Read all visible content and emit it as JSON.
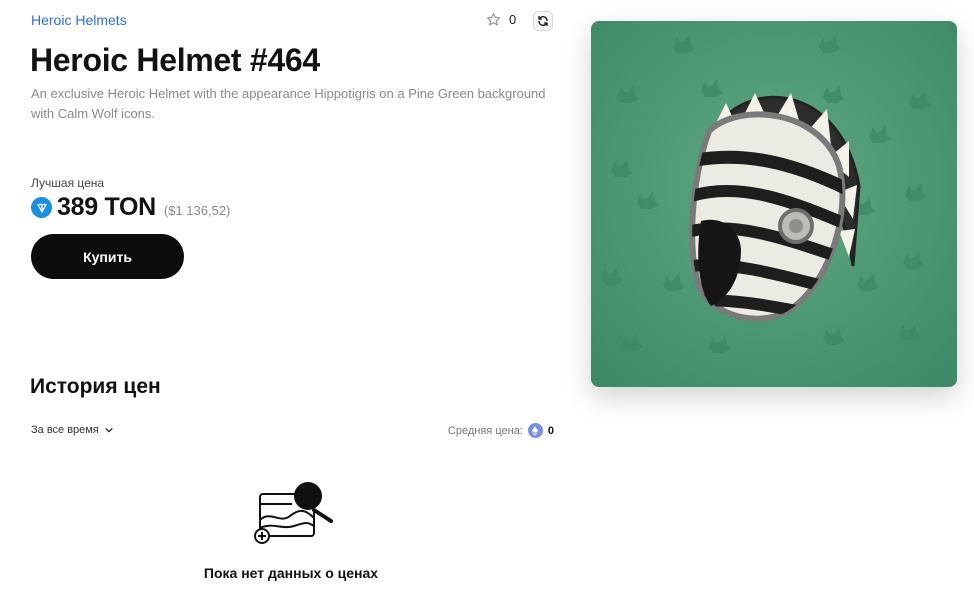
{
  "collection": {
    "name": "Heroic Helmets"
  },
  "favorites": {
    "count": "0"
  },
  "item": {
    "title": "Heroic Helmet #464",
    "description": "An exclusive Heroic Helmet with the appearance Hippotigris on a Pine Green background with Calm Wolf icons."
  },
  "price": {
    "label": "Лучшая цена",
    "value": "389 TON",
    "usd": "($1 136,52)"
  },
  "buy": {
    "label": "Купить"
  },
  "history": {
    "title": "История цен",
    "period": "За все время",
    "avg_label": "Средняя цена:",
    "avg_value": "0",
    "empty_text": "Пока нет данных о ценах"
  },
  "icons": [
    "star-icon",
    "refresh-icon",
    "ton-icon",
    "chevron-down-icon",
    "eth-icon",
    "empty-chart-icon"
  ],
  "colors": {
    "accent_link": "#2f6fdf",
    "button_bg": "#0c0c0e",
    "ton_blue": "#1a8fe3",
    "card_bg": "#4e9a77"
  }
}
